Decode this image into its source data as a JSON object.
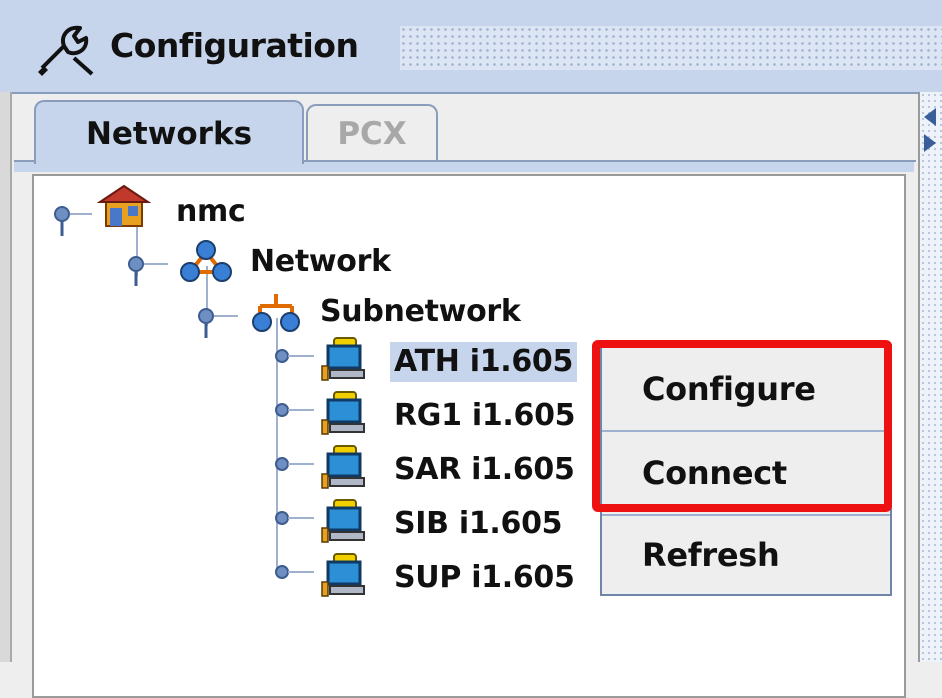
{
  "window": {
    "title": "Configuration",
    "icon": "wrench-icon"
  },
  "tabs": [
    {
      "label": "Networks",
      "active": true
    },
    {
      "label": "PCX",
      "active": false
    }
  ],
  "tree": {
    "root": {
      "label": "nmc",
      "icon": "house-icon"
    },
    "network": {
      "label": "Network",
      "icon": "network-icon"
    },
    "subnetwork": {
      "label": "Subnetwork",
      "icon": "subnetwork-icon"
    },
    "devices": [
      {
        "label": "ATH i1.605",
        "icon": "computer-icon",
        "selected": true
      },
      {
        "label": "RG1 i1.605",
        "icon": "computer-icon",
        "selected": false
      },
      {
        "label": "SAR i1.605",
        "icon": "computer-icon",
        "selected": false
      },
      {
        "label": "SIB i1.605",
        "icon": "computer-icon",
        "selected": false
      },
      {
        "label": "SUP i1.605",
        "icon": "computer-icon",
        "selected": false
      }
    ]
  },
  "context_menu": {
    "items": [
      {
        "label": "Configure"
      },
      {
        "label": "Connect"
      },
      {
        "label": "Refresh"
      }
    ],
    "highlight_color": "#ee1111"
  },
  "colors": {
    "accent": "#c7d5ec",
    "tree_lines": "#9fb1cf",
    "highlight": "#ee1111"
  }
}
